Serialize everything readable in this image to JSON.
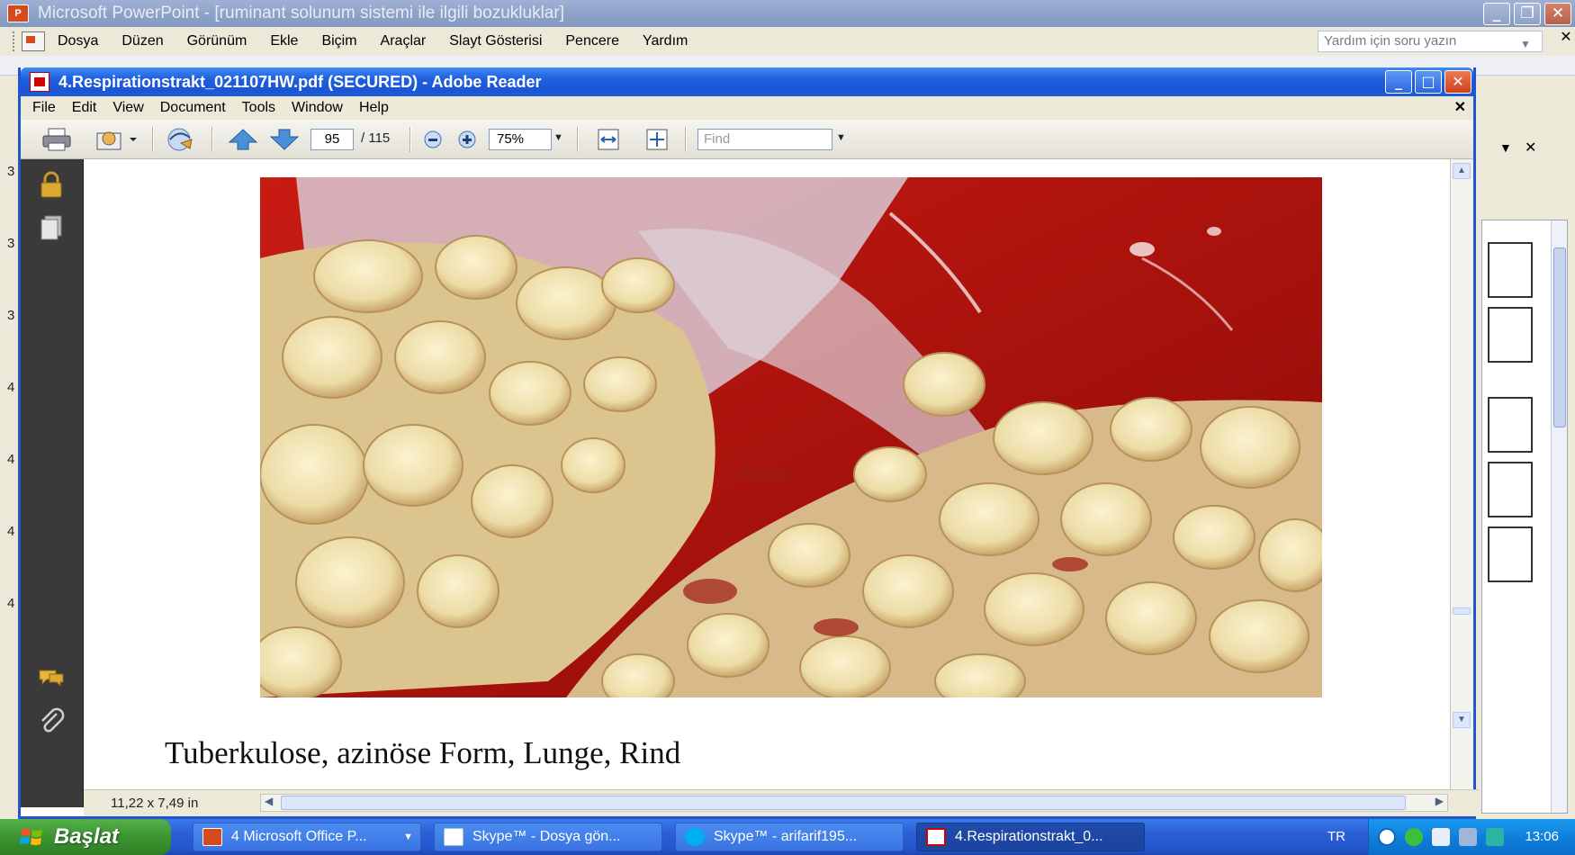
{
  "powerpoint": {
    "title": "Microsoft PowerPoint - [ruminant solunum sistemi ile ilgili bozukluklar]",
    "menu": [
      "Dosya",
      "Düzen",
      "Görünüm",
      "Ekle",
      "Biçim",
      "Araçlar",
      "Slayt Gösterisi",
      "Pencere",
      "Yardım"
    ],
    "help_placeholder": "Yardım için soru yazın",
    "ruler_numbers": [
      "3",
      "3",
      "3",
      "4",
      "4",
      "4",
      "4"
    ]
  },
  "reader": {
    "title": "4.Respirationstrakt_021107HW.pdf (SECURED) - Adobe Reader",
    "menu": [
      "File",
      "Edit",
      "View",
      "Document",
      "Tools",
      "Window",
      "Help"
    ],
    "toolbar": {
      "current_page": "95",
      "page_total": "/ 115",
      "zoom": "75%",
      "find_placeholder": "Find"
    },
    "page": {
      "caption": "Tuberkulose, azinöse Form, Lunge, Rind"
    },
    "status": {
      "page_size": "11,22 x 7,49 in"
    }
  },
  "taskbar": {
    "start_label": "Başlat",
    "tasks": [
      {
        "label": "4 Microsoft Office P...",
        "icon": "powerpoint-icon"
      },
      {
        "label": "Skype™ - Dosya gön...",
        "icon": "skype-file-icon"
      },
      {
        "label": "Skype™ - arifarif195...",
        "icon": "skype-icon"
      },
      {
        "label": "4.Respirationstrakt_0...",
        "icon": "adobe-reader-icon"
      }
    ],
    "language": "TR",
    "clock": "13:06"
  },
  "colors": {
    "xp_blue": "#1f5fde",
    "start_green": "#3b9530",
    "reader_red": "#d20000",
    "tissue_red": "#b81010",
    "lesion_cream": "#efe3b4"
  }
}
